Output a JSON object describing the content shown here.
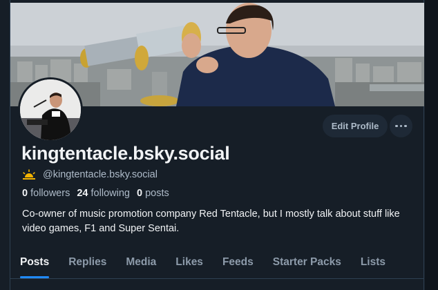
{
  "profile": {
    "display_name": "kingtentacle.bsky.social",
    "handle": "@kingtentacle.bsky.social",
    "handle_icon": "sunrise-emoji-icon",
    "followers_count": "0",
    "followers_label": "followers",
    "following_count": "24",
    "following_label": "following",
    "posts_count": "0",
    "posts_label": "posts",
    "bio": "Co-owner of music promotion company Red Tentacle, but I mostly talk about stuff like video games, F1 and Super Sentai."
  },
  "actions": {
    "edit_label": "Edit Profile",
    "more_icon": "ellipsis-icon"
  },
  "tabs": [
    {
      "label": "Posts",
      "active": true
    },
    {
      "label": "Replies",
      "active": false
    },
    {
      "label": "Media",
      "active": false
    },
    {
      "label": "Likes",
      "active": false
    },
    {
      "label": "Feeds",
      "active": false
    },
    {
      "label": "Starter Packs",
      "active": false
    },
    {
      "label": "Lists",
      "active": false
    }
  ],
  "colors": {
    "background": "#161e27",
    "accent": "#208bfe",
    "text_primary": "#f1f3f5",
    "text_secondary": "#aebbc9"
  }
}
